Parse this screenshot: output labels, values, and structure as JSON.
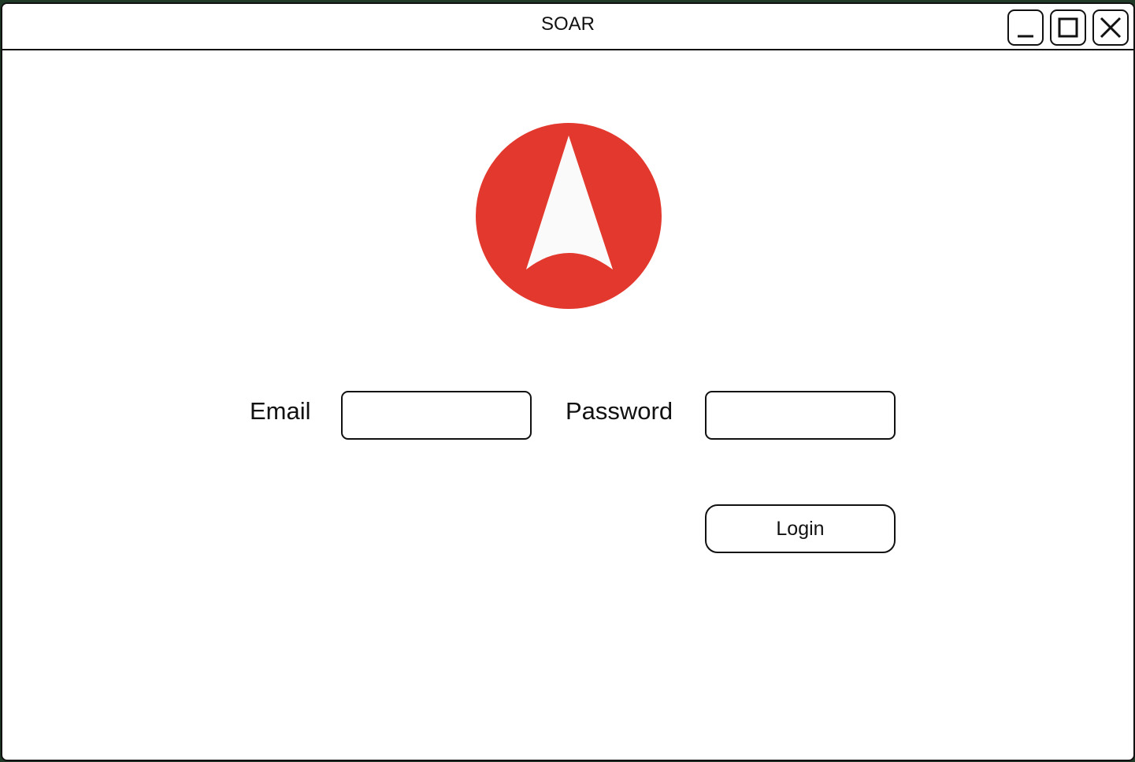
{
  "window": {
    "title": "SOAR",
    "controls": {
      "minimize_icon": "minimize-icon",
      "maximize_icon": "maximize-icon",
      "close_icon": "close-icon"
    }
  },
  "logo": {
    "icon": "arrow-logo",
    "circle_color": "#e3382d",
    "arrow_color": "#fafafa"
  },
  "form": {
    "email_label": "Email",
    "email_value": "",
    "password_label": "Password",
    "password_value": "",
    "login_label": "Login"
  }
}
